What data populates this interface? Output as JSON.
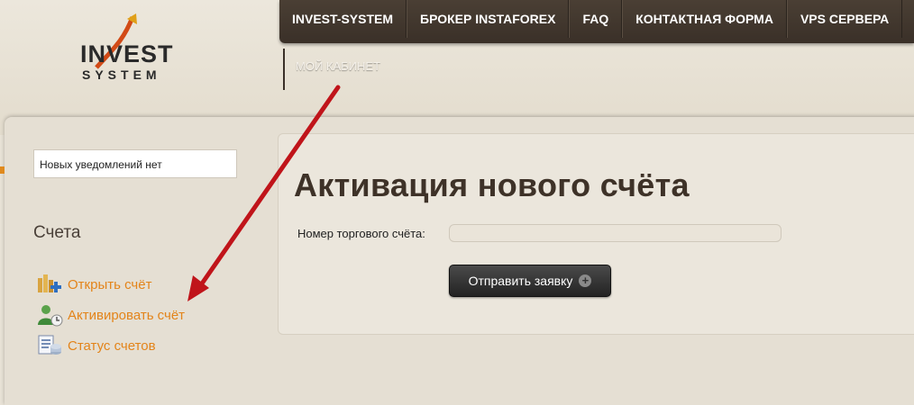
{
  "logo": {
    "word": "INVEST",
    "sub": "SYSTEM"
  },
  "nav": {
    "items": [
      "INVEST-SYSTEM",
      "БРОКЕР INSTAFOREX",
      "FAQ",
      "КОНТАКТНАЯ ФОРМА",
      "VPS СЕРВЕРА"
    ],
    "sub_item": "МОЙ КАБИНЕТ"
  },
  "sidebar": {
    "notice": "Новых уведомлений нет",
    "section_title": "Счета",
    "items": [
      {
        "label": "Открыть счёт",
        "icon": "open-account-icon"
      },
      {
        "label": "Активировать счёт",
        "icon": "activate-account-icon"
      },
      {
        "label": "Статус счетов",
        "icon": "accounts-status-icon"
      }
    ]
  },
  "main": {
    "title": "Активация нового счёта",
    "field_label": "Номер торгового счёта:",
    "field_value": "",
    "submit_label": "Отправить заявку"
  },
  "colors": {
    "nav_bg": "#3f352c",
    "link_orange": "#e3841a",
    "arrow_red": "#c0141a"
  }
}
